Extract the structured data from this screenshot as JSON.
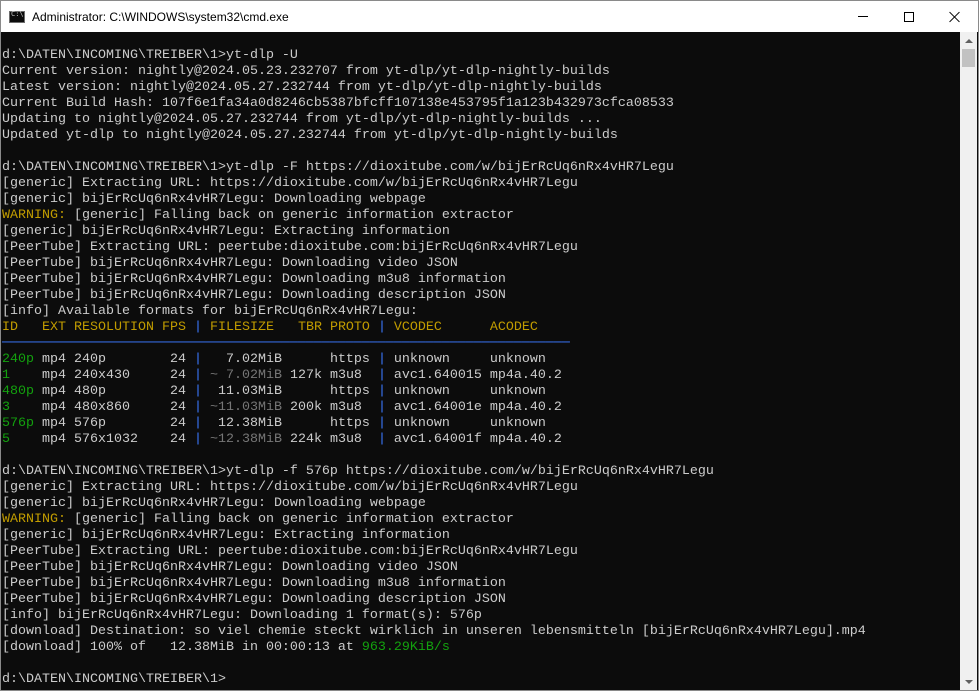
{
  "window": {
    "title": "Administrator: C:\\WINDOWS\\system32\\cmd.exe"
  },
  "colors": {
    "background": "#0c0c0c",
    "text": "#cccccc",
    "warning": "#c19c00",
    "highlight": "#13a10e",
    "separator": "#3b78ff"
  },
  "lines": [
    "d:\\DATEN\\INCOMING\\TREIBER\\1>yt-dlp -U",
    "Current version: nightly@2024.05.23.232707 from yt-dlp/yt-dlp-nightly-builds",
    "Latest version: nightly@2024.05.27.232744 from yt-dlp/yt-dlp-nightly-builds",
    "Current Build Hash: 107f6e1fa34a0d8246cb5387bfcff107138e453795f1a123b432973cfca08533",
    "Updating to nightly@2024.05.27.232744 from yt-dlp/yt-dlp-nightly-builds ...",
    "Updated yt-dlp to nightly@2024.05.27.232744 from yt-dlp/yt-dlp-nightly-builds",
    "",
    "d:\\DATEN\\INCOMING\\TREIBER\\1>yt-dlp -F https://dioxitube.com/w/bijErRcUq6nRx4vHR7Legu",
    "[generic] Extracting URL: https://dioxitube.com/w/bijErRcUq6nRx4vHR7Legu",
    "[generic] bijErRcUq6nRx4vHR7Legu: Downloading webpage",
    "WARNING: [generic] Falling back on generic information extractor",
    "[generic] bijErRcUq6nRx4vHR7Legu: Extracting information",
    "[PeerTube] Extracting URL: peertube:dioxitube.com:bijErRcUq6nRx4vHR7Legu",
    "[PeerTube] bijErRcUq6nRx4vHR7Legu: Downloading video JSON",
    "[PeerTube] bijErRcUq6nRx4vHR7Legu: Downloading m3u8 information",
    "[PeerTube] bijErRcUq6nRx4vHR7Legu: Downloading description JSON",
    "[info] Available formats for bijErRcUq6nRx4vHR7Legu:",
    "ID   EXT RESOLUTION FPS | FILESIZE   TBR PROTO | VCODEC      ACODEC",
    "───────────────────────────────────────────────────────────────────────",
    "240p mp4 240p        24 |   7.02MiB      https | unknown     unknown",
    "1    mp4 240x430     24 | ~ 7.02MiB 127k m3u8  | avc1.640015 mp4a.40.2",
    "480p mp4 480p        24 |  11.03MiB      https | unknown     unknown",
    "3    mp4 480x860     24 | ~11.03MiB 200k m3u8  | avc1.64001e mp4a.40.2",
    "576p mp4 576p        24 |  12.38MiB      https | unknown     unknown",
    "5    mp4 576x1032    24 | ~12.38MiB 224k m3u8  | avc1.64001f mp4a.40.2",
    "",
    "d:\\DATEN\\INCOMING\\TREIBER\\1>yt-dlp -f 576p https://dioxitube.com/w/bijErRcUq6nRx4vHR7Legu",
    "[generic] Extracting URL: https://dioxitube.com/w/bijErRcUq6nRx4vHR7Legu",
    "[generic] bijErRcUq6nRx4vHR7Legu: Downloading webpage",
    "WARNING: [generic] Falling back on generic information extractor",
    "[generic] bijErRcUq6nRx4vHR7Legu: Extracting information",
    "[PeerTube] Extracting URL: peertube:dioxitube.com:bijErRcUq6nRx4vHR7Legu",
    "[PeerTube] bijErRcUq6nRx4vHR7Legu: Downloading video JSON",
    "[PeerTube] bijErRcUq6nRx4vHR7Legu: Downloading m3u8 information",
    "[PeerTube] bijErRcUq6nRx4vHR7Legu: Downloading description JSON",
    "[info] bijErRcUq6nRx4vHR7Legu: Downloading 1 format(s): 576p",
    "[download] Destination: so viel chemie steckt wirklich in unseren lebensmitteln [bijErRcUq6nRx4vHR7Legu].mp4",
    "[download] 100% of   12.38MiB in 00:00:13 at 963.29KiB/s",
    "",
    "d:\\DATEN\\INCOMING\\TREIBER\\1>"
  ]
}
